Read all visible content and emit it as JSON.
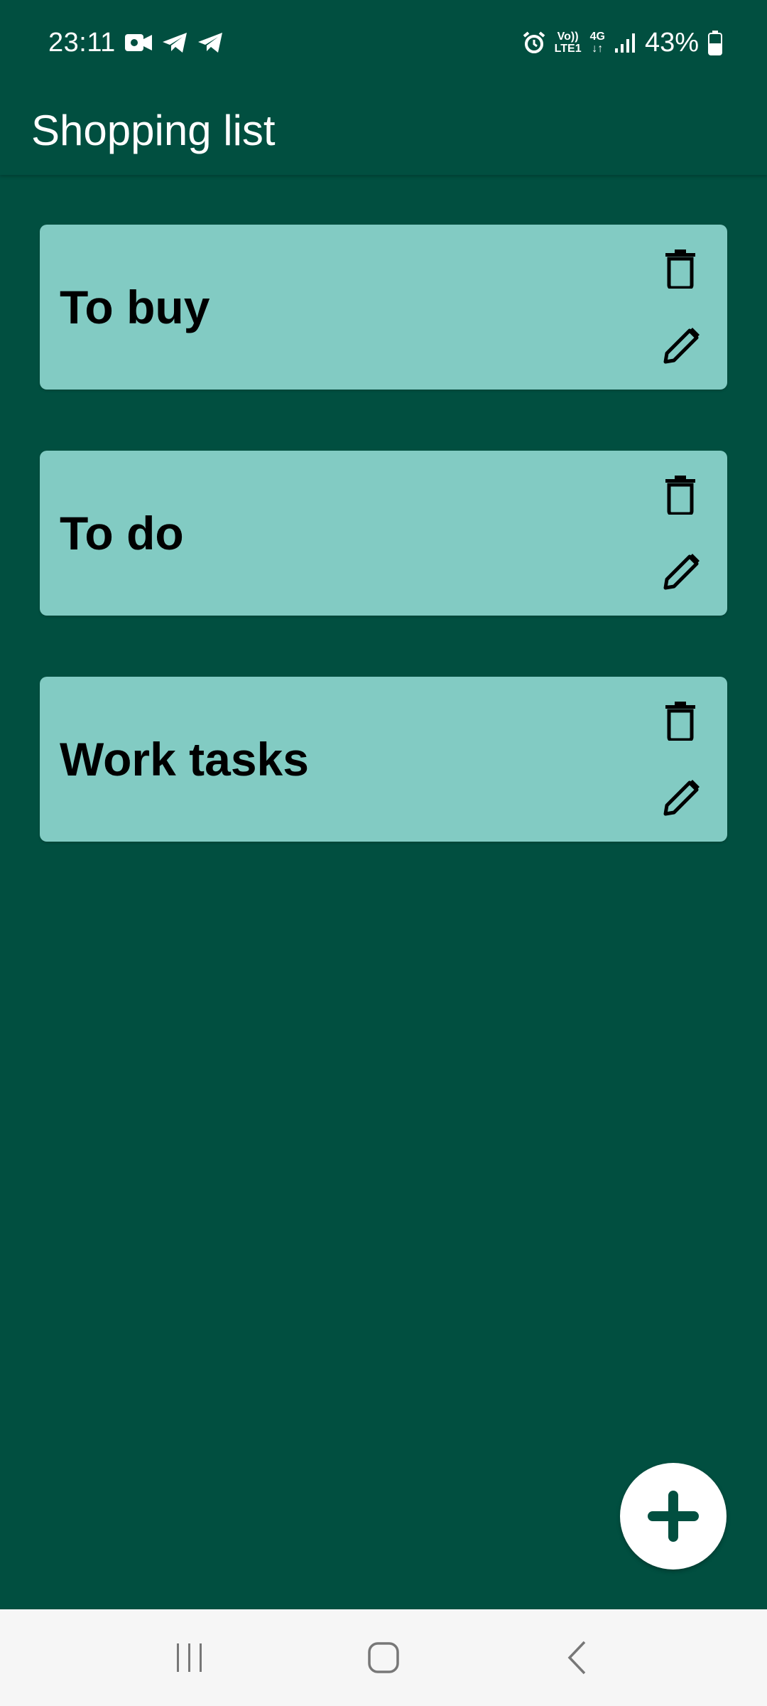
{
  "status_bar": {
    "time": "23:11",
    "left_icons": [
      "video-icon",
      "telegram-icon",
      "telegram-icon"
    ],
    "right_icons": [
      "alarm-icon",
      "volte-icon",
      "4g-icon",
      "signal-icon",
      "battery-icon"
    ],
    "volte_top": "Vo))",
    "volte_bottom": "LTE1",
    "network": "4G",
    "battery": "43%"
  },
  "app_bar": {
    "title": "Shopping list"
  },
  "lists": [
    {
      "title": "To buy"
    },
    {
      "title": "To do"
    },
    {
      "title": "Work tasks"
    }
  ],
  "fab": {
    "icon": "plus-icon"
  },
  "nav_bar": {
    "buttons": [
      "recent-apps",
      "home",
      "back"
    ]
  },
  "colors": {
    "background": "#014f40",
    "card": "#82cbc3",
    "fab": "#ffffff",
    "nav_bar": "#f6f6f6"
  }
}
